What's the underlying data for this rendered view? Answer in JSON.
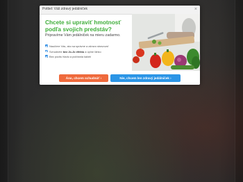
{
  "modal": {
    "window_title": "Pottiel: Váš zdravý jedálniček",
    "close_glyph": "×",
    "headline": "Chcete si upraviť hmotnosť podľa svojich predstáv?",
    "subheadline": "Pripravíme Vám jedálniček na mieru zadarmo.",
    "bullets": [
      {
        "pre": "Naučíme Vás, ako sa správne a zdravo stravovať",
        "bold": "",
        "post": ""
      },
      {
        "pre": "Schudnete ",
        "bold": "bez Jo-Jo efektu",
        "post": " a úplne ľahko"
      },
      {
        "pre": "Bez pocitu hladu a počítania kalórií",
        "bold": "",
        "post": ""
      }
    ],
    "primary_button": "Áno, chcem schudnúť ›",
    "secondary_button": "Nie, chcem len zdravý jedálniček ›"
  },
  "colors": {
    "headline": "#3fae3a",
    "primary_button": "#ef6a3c",
    "secondary_button": "#2b95e6",
    "check_bullet": "#2f8de4",
    "overlay": "#1f1f1f"
  },
  "icons": {
    "bullet": "check-icon",
    "close": "close-icon"
  }
}
